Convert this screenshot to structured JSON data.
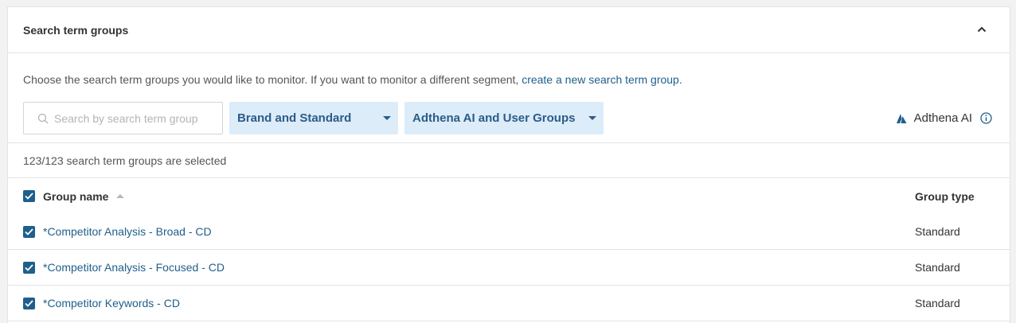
{
  "panel": {
    "title": "Search term groups",
    "description_prefix": "Choose the search term groups you would like to monitor. If you want to monitor a different segment, ",
    "description_link": "create a new search term group",
    "description_suffix": "."
  },
  "filters": {
    "search_placeholder": "Search by search term group",
    "dropdown_type": "Brand and Standard",
    "dropdown_source": "Adthena AI and User Groups",
    "ai_label": "Adthena AI"
  },
  "selection": {
    "count_text": "123/123 search term groups are selected"
  },
  "table": {
    "columns": {
      "name": "Group name",
      "type": "Group type"
    },
    "rows": [
      {
        "name": "*Competitor Analysis - Broad - CD",
        "type": "Standard"
      },
      {
        "name": "*Competitor Analysis - Focused - CD",
        "type": "Standard"
      },
      {
        "name": "*Competitor Keywords - CD",
        "type": "Standard"
      }
    ]
  },
  "colors": {
    "accent": "#1f5f8b",
    "dropdown_bg": "#dcecf9"
  }
}
